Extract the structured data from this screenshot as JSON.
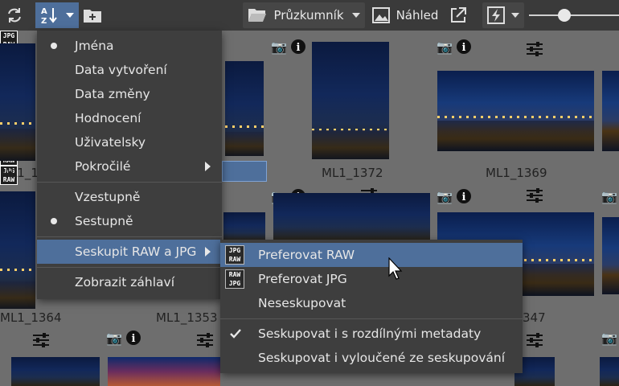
{
  "toolbar": {
    "explorer_label": "Průzkumník",
    "preview_label": "Náhled",
    "sort_icon_letters": "AZ"
  },
  "thumbnails": [
    {
      "caption": "ML1_13"
    },
    {
      "caption": ""
    },
    {
      "caption": "ML1_1372"
    },
    {
      "caption": "ML1_1369"
    },
    {
      "caption": "ML1_1364"
    },
    {
      "caption": "ML1_1353"
    },
    {
      "caption": "347"
    }
  ],
  "badge": {
    "top": "JPG",
    "bottom": "RAW"
  },
  "sort_menu": {
    "items": [
      {
        "label": "Jména",
        "selected": true
      },
      {
        "label": "Data vytvoření",
        "selected": false
      },
      {
        "label": "Data změny",
        "selected": false
      },
      {
        "label": "Hodnocení",
        "selected": false
      },
      {
        "label": "Uživatelsky",
        "selected": false
      },
      {
        "label": "Pokročilé",
        "submenu": true
      }
    ],
    "order": [
      {
        "label": "Vzestupně",
        "selected": false
      },
      {
        "label": "Sestupně",
        "selected": true
      }
    ],
    "group_raw_jpg": "Seskupit RAW a JPG",
    "show_headers": "Zobrazit záhlaví"
  },
  "group_submenu": {
    "items": [
      {
        "label": "Preferovat RAW",
        "icon_top": "JPG",
        "icon_bottom": "RAW",
        "highlighted": true
      },
      {
        "label": "Preferovat JPG",
        "icon_top": "RAW",
        "icon_bottom": "JPG"
      },
      {
        "label": "Neseskupovat"
      }
    ],
    "options": [
      {
        "label": "Seskupovat i s rozdílnými metadaty",
        "checked": true
      },
      {
        "label": "Seskupovat i vyloučené ze seskupování",
        "checked": false
      }
    ]
  },
  "colors": {
    "accent": "#4e6f9b",
    "toolbar_bg": "#3a3a3a",
    "grid_bg": "#6e6e6e",
    "menu_bg": "#3e3e3e"
  }
}
